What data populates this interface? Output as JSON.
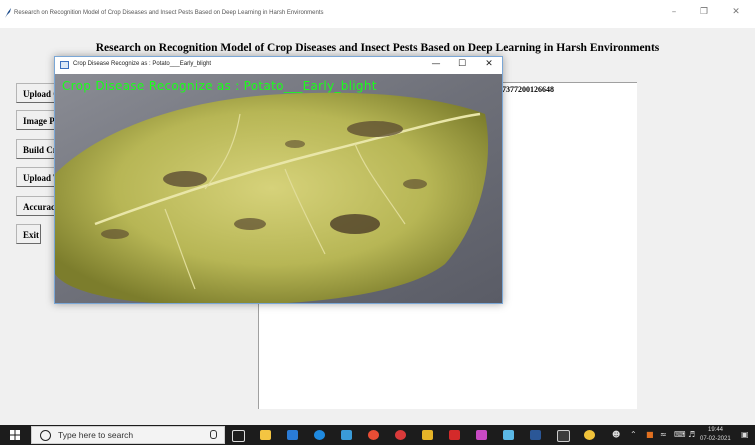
{
  "main_window": {
    "title": "Research on Recognition Model of Crop Diseases and Insect Pests Based on Deep Learning in Harsh Environments",
    "minimize": "–",
    "restore": "❐",
    "close": "✕"
  },
  "heading": "Research on Recognition Model of Crop Diseases and Insect Pests Based on Deep Learning in Harsh Environments",
  "buttons": [
    "Upload C",
    "Image Pr",
    "Build Cr",
    "Upload T",
    "Accuracy",
    "Exit"
  ],
  "output_text": "27377200126648",
  "image_window": {
    "title": "Crop Disease Recognize as : Potato___Early_blight",
    "overlay_text": "Crop Disease Recognize as : Potato___Early_blight",
    "minimize": "—",
    "maximize": "☐",
    "close": "✕"
  },
  "taskbar": {
    "search_placeholder": "Type here to search",
    "time": "19:44",
    "date": "07-02-2021",
    "icons": [
      "task-view-icon",
      "store-icon",
      "mail-icon",
      "edge-icon",
      "photos-icon",
      "chrome-icon",
      "opera-icon",
      "files-icon",
      "acrobat-icon",
      "paint-icon",
      "viewer-icon",
      "word-icon",
      "terminal-icon",
      "python-icon"
    ]
  },
  "colors": {
    "overlay_text": "#1aff1a",
    "window_border": "#7aa7d6"
  }
}
